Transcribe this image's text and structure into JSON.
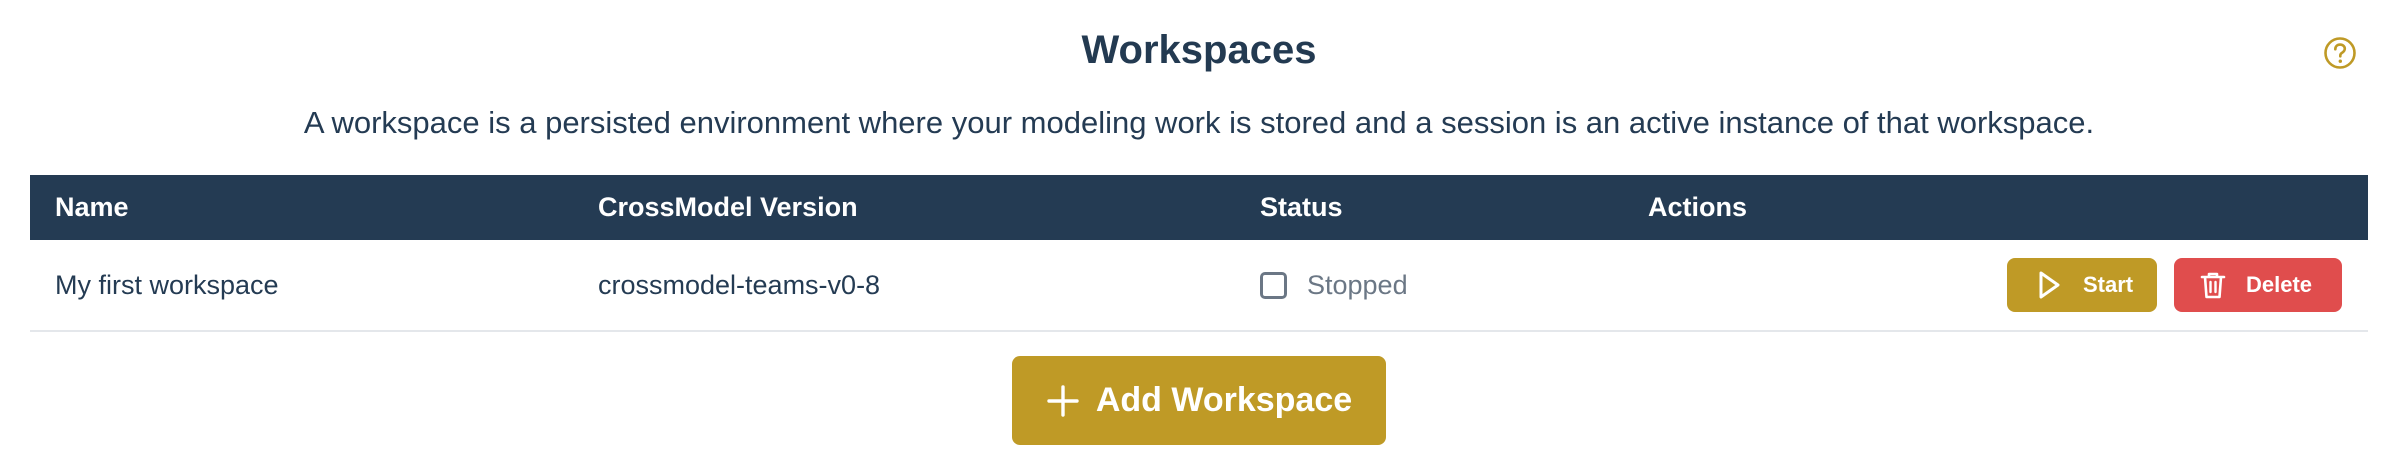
{
  "header": {
    "title": "Workspaces",
    "description": "A workspace is a persisted environment where your modeling work is stored and a session is an active instance of that workspace.",
    "help_icon": "question-circle-icon"
  },
  "colors": {
    "header_bg": "#243b53",
    "accent": "#bf9a26",
    "danger": "#e04d4d",
    "text": "#243b53",
    "muted": "#6b7785"
  },
  "table": {
    "columns": [
      "Name",
      "CrossModel Version",
      "Status",
      "Actions"
    ],
    "rows": [
      {
        "name": "My first workspace",
        "version": "crossmodel-teams-v0-8",
        "status": "Stopped",
        "status_checked": false,
        "actions": [
          {
            "label": "Start",
            "icon": "play-icon"
          },
          {
            "label": "Delete",
            "icon": "trash-icon"
          }
        ]
      }
    ]
  },
  "add_button": {
    "label": "Add Workspace",
    "icon": "plus-icon"
  }
}
